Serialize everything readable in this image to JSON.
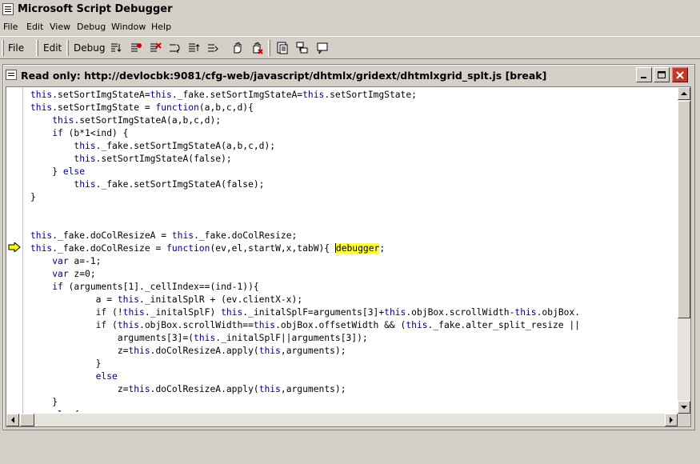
{
  "app": {
    "title": "Microsoft Script Debugger"
  },
  "menu": [
    "File",
    "Edit",
    "View",
    "Debug",
    "Window",
    "Help"
  ],
  "toolbar": {
    "file_label": "File",
    "edit_label": "Edit",
    "debug_label": "Debug"
  },
  "document": {
    "title": "Read only: http://devlocbk:9081/cfg-web/javascript/dhtmlx/gridext/dhtmlxgrid_splt.js [break]"
  },
  "code_lines": [
    "this.setSortImgStateA=this._fake.setSortImgStateA=this.setSortImgState;",
    "this.setSortImgState = function(a,b,c,d){",
    "    this.setSortImgStateA(a,b,c,d);",
    "    if (b*1<ind) {",
    "        this._fake.setSortImgStateA(a,b,c,d);",
    "        this.setSortImgStateA(false);",
    "    } else",
    "        this._fake.setSortImgStateA(false);",
    "}",
    "",
    "",
    "this._fake.doColResizeA = this._fake.doColResize;",
    "this._fake.doColResize = function(ev,el,startW,x,tabW){ ",
    "    var a=-1;",
    "    var z=0;",
    "    if (arguments[1]._cellIndex==(ind-1)){",
    "            a = this._initalSplR + (ev.clientX-x);",
    "            if (!this._initalSplF) this._initalSplF=arguments[3]+this.objBox.scrollWidth-this.objBox.",
    "            if (this.objBox.scrollWidth==this.objBox.offsetWidth && (this._fake.alter_split_resize ||",
    "                arguments[3]=(this._initalSplF||arguments[3]);",
    "                z=this.doColResizeA.apply(this,arguments);",
    "            }",
    "            else",
    "                z=this.doColResizeA.apply(this,arguments);",
    "    }",
    "    else{"
  ],
  "current_line": 13,
  "highlighted_token": "debugger",
  "icons": {
    "toolbar": [
      "step-into-icon",
      "breakpoint-icon",
      "clear-breakpoints-icon",
      "step-over-icon",
      "step-out-icon",
      "stop-icon",
      "break-icon",
      "running-documents-icon",
      "call-stack-icon",
      "command-window-icon"
    ],
    "current_line_marker": "current-statement-arrow-icon"
  }
}
